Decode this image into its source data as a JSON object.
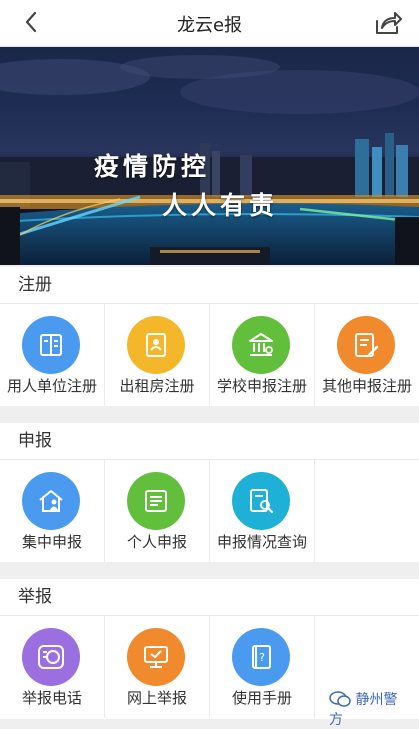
{
  "header": {
    "title": "龙云e报"
  },
  "banner": {
    "line1": "疫情防控",
    "line2": "人人有责"
  },
  "sections": [
    {
      "title": "注册",
      "items": [
        {
          "label": "用人单位注册",
          "icon": "building-doc-icon",
          "color": "#4a9bf0"
        },
        {
          "label": "出租房注册",
          "icon": "id-card-icon",
          "color": "#f5b72a"
        },
        {
          "label": "学校申报注册",
          "icon": "school-icon",
          "color": "#62bf3c"
        },
        {
          "label": "其他申报注册",
          "icon": "form-edit-icon",
          "color": "#f08a2c"
        }
      ]
    },
    {
      "title": "申报",
      "items": [
        {
          "label": "集中申报",
          "icon": "house-person-icon",
          "color": "#4a9bf0"
        },
        {
          "label": "个人申报",
          "icon": "list-doc-icon",
          "color": "#62bf3c"
        },
        {
          "label": "申报情况查询",
          "icon": "search-doc-icon",
          "color": "#1fb0d8"
        }
      ]
    },
    {
      "title": "举报",
      "items": [
        {
          "label": "举报电话",
          "icon": "report-phone-icon",
          "color": "#9b6fe0"
        },
        {
          "label": "网上举报",
          "icon": "monitor-icon",
          "color": "#f08a2c"
        },
        {
          "label": "使用手册",
          "icon": "manual-book-icon",
          "color": "#4a9bf0"
        }
      ]
    }
  ],
  "watermark": {
    "text": "静州警方"
  }
}
